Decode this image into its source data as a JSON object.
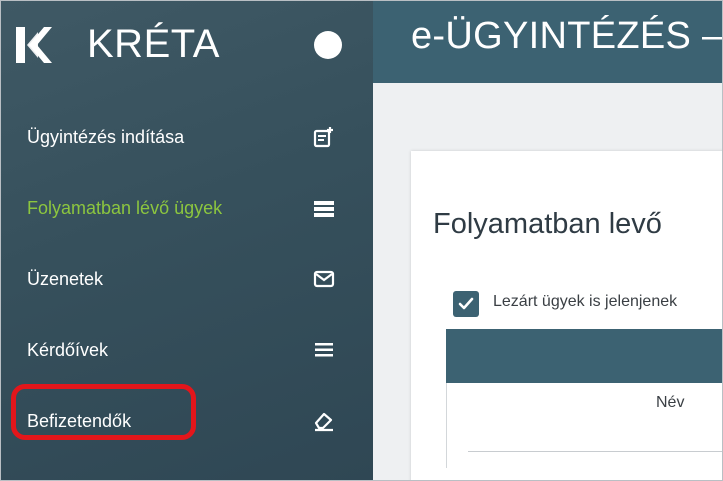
{
  "brand": {
    "name": "KRÉTA"
  },
  "header": {
    "title": "e-ÜGYINTÉZÉS –"
  },
  "sidebar": {
    "items": [
      {
        "label": "Ügyintézés indítása",
        "icon": "add-document-icon",
        "active": false
      },
      {
        "label": "Folyamatban lévő ügyek",
        "icon": "list-icon",
        "active": true
      },
      {
        "label": "Üzenetek",
        "icon": "envelope-icon",
        "active": false
      },
      {
        "label": "Kérdőívek",
        "icon": "list-lines-icon",
        "active": false
      },
      {
        "label": "Befizetendők",
        "icon": "eraser-icon",
        "active": false
      }
    ]
  },
  "main": {
    "heading": "Folyamatban levő",
    "closed_cases_checkbox": {
      "label": "Lezárt ügyek is jelenjenek",
      "checked": true
    },
    "table": {
      "column_label": "Név"
    }
  },
  "colors": {
    "sidebar": "#3f5965",
    "header": "#3c6272",
    "active": "#8cc63f",
    "highlight": "#e3161b"
  }
}
